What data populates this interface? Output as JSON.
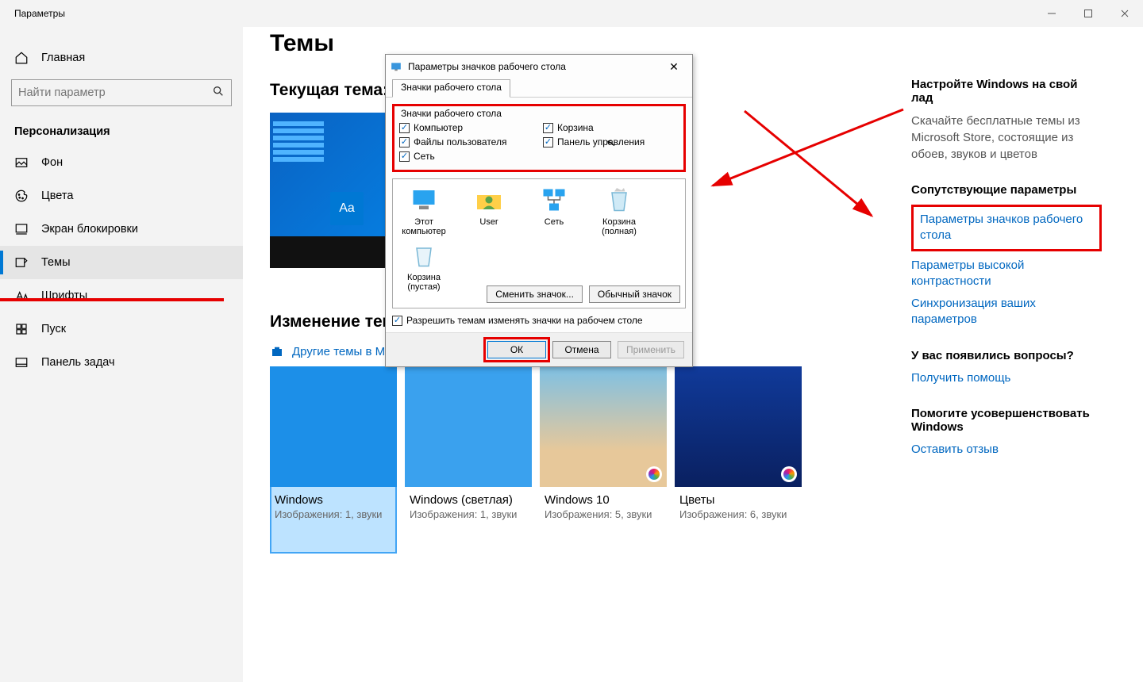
{
  "window": {
    "title": "Параметры"
  },
  "sidebar": {
    "home": "Главная",
    "search_placeholder": "Найти параметр",
    "category": "Персонализация",
    "items": [
      {
        "label": "Фон"
      },
      {
        "label": "Цвета"
      },
      {
        "label": "Экран блокировки"
      },
      {
        "label": "Темы"
      },
      {
        "label": "Шрифты"
      },
      {
        "label": "Пуск"
      },
      {
        "label": "Панель задач"
      }
    ]
  },
  "main": {
    "title": "Темы",
    "current_theme_label": "Текущая тема: W",
    "aa": "Aa",
    "change_theme": "Изменение темы",
    "more_themes": "Другие темы в Mi",
    "themes": [
      {
        "name": "Windows",
        "meta": "Изображения: 1, звуки"
      },
      {
        "name": "Windows (светлая)",
        "meta": "Изображения: 1, звуки"
      },
      {
        "name": "Windows 10",
        "meta": "Изображения: 5, звуки"
      },
      {
        "name": "Цветы",
        "meta": "Изображения: 6, звуки"
      }
    ]
  },
  "right": {
    "heading1": "Настройте Windows на свой лад",
    "text1": "Скачайте бесплатные темы из Microsoft Store, состоящие из обоев, звуков и цветов",
    "heading2": "Сопутствующие параметры",
    "link_desktop_icons": "Параметры значков рабочего стола",
    "link_contrast": "Параметры высокой контрастности",
    "link_sync": "Синхронизация ваших параметров",
    "heading3": "У вас появились вопросы?",
    "link_help": "Получить помощь",
    "heading4": "Помогите усовершенствовать Windows",
    "link_feedback": "Оставить отзыв"
  },
  "dialog": {
    "title": "Параметры значков рабочего стола",
    "tab": "Значки рабочего стола",
    "group_title": "Значки рабочего стола",
    "checks": {
      "computer": "Компьютер",
      "recycle": "Корзина",
      "userfiles": "Файлы пользователя",
      "cpanel": "Панель управления",
      "network": "Сеть"
    },
    "icons": {
      "this_pc": "Этот компьютер",
      "user": "User",
      "network": "Сеть",
      "recycle_full": "Корзина (полная)",
      "recycle_empty": "Корзина (пустая)"
    },
    "btn_change": "Сменить значок...",
    "btn_default": "Обычный значок",
    "allow_themes": "Разрешить темам изменять значки на рабочем столе",
    "ok": "ОК",
    "cancel": "Отмена",
    "apply": "Применить"
  }
}
